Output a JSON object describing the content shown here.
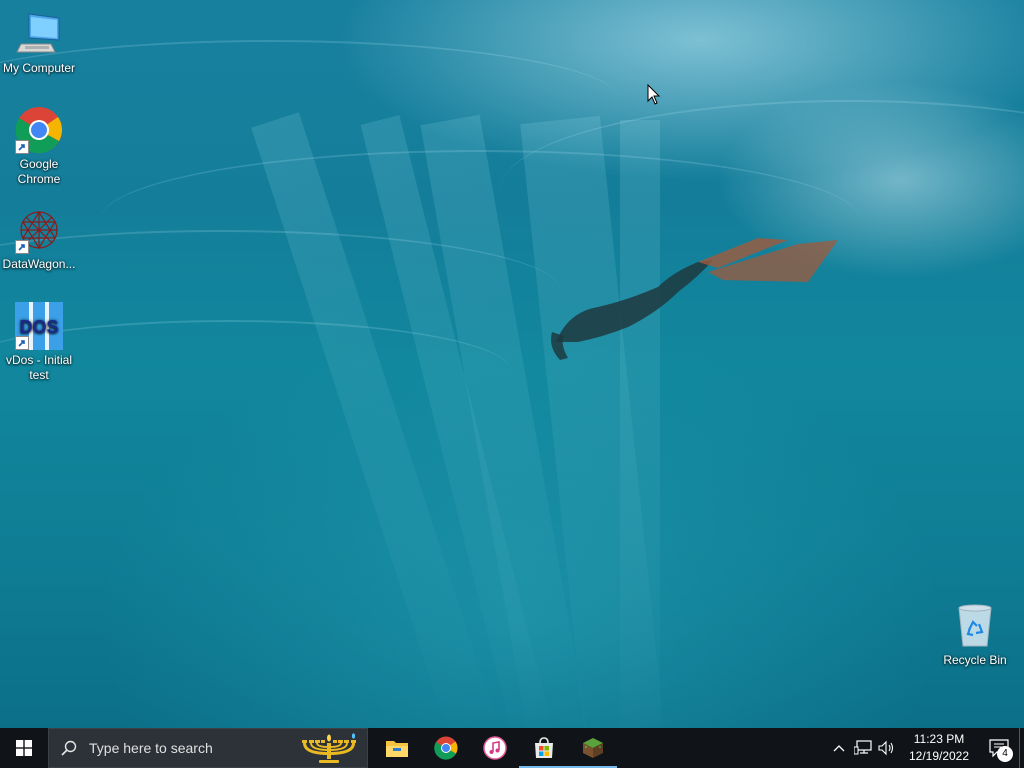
{
  "desktop": {
    "icons": [
      {
        "label": "My Computer",
        "icon": "computer-icon"
      },
      {
        "label": "Google Chrome",
        "icon": "chrome-icon",
        "shortcut": true
      },
      {
        "label": "DataWagon...",
        "icon": "datawagon-icon",
        "shortcut": true
      },
      {
        "label": "vDos - Initial test",
        "icon": "vdos-icon",
        "icon_text": "DOS",
        "shortcut": true
      },
      {
        "label": "Recycle Bin",
        "icon": "recycle-bin-icon"
      }
    ]
  },
  "taskbar": {
    "search": {
      "placeholder": "Type here to search"
    },
    "pinned_apps": [
      {
        "name": "File Explorer",
        "icon": "folder-icon",
        "running": false
      },
      {
        "name": "Google Chrome",
        "icon": "chrome-icon",
        "running": false
      },
      {
        "name": "iTunes",
        "icon": "itunes-icon",
        "running": false
      },
      {
        "name": "Microsoft Store",
        "icon": "store-icon",
        "running": true
      },
      {
        "name": "Minecraft",
        "icon": "minecraft-icon",
        "running": true
      }
    ],
    "tray": {
      "time": "11:23 PM",
      "date": "12/19/2022",
      "notification_count": "4"
    }
  },
  "colors": {
    "taskbar_bg": "#101418",
    "accent": "#76b9ed",
    "water": "#11879d"
  }
}
